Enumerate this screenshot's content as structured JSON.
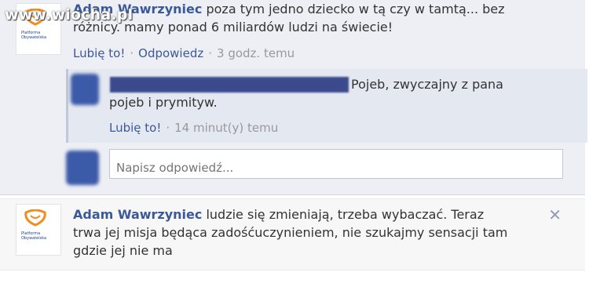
{
  "watermark": "www.wiocha.pl",
  "logo_text": "Platforma Obywatelska",
  "comment1": {
    "author": "Adam Wawrzyniec",
    "text": "poza tym jedno dziecko w tą czy w tamtą... bez różnicy. mamy ponad 6 miliardów ludzi na świecie!",
    "like": "Lubię to!",
    "reply": "Odpowiedz",
    "time": "3 godz. temu"
  },
  "reply1": {
    "text": "Pojeb, zwyczajny z pana pojeb i prymityw.",
    "like": "Lubię to!",
    "time": "14 minut(y) temu"
  },
  "reply_input": {
    "placeholder": "Napisz odpowiedź..."
  },
  "comment2": {
    "author": "Adam Wawrzyniec",
    "text": "ludzie się zmieniają, trzeba wybaczać. Teraz trwa jej misja będąca zadośćuczynieniem, nie szukajmy sensacji tam gdzie jej nie ma",
    "close": "✕"
  },
  "colors": {
    "link": "#3b5998",
    "thread_bg": "#edeff4",
    "reply_bg": "#e4e8f1",
    "meta": "#999999"
  }
}
